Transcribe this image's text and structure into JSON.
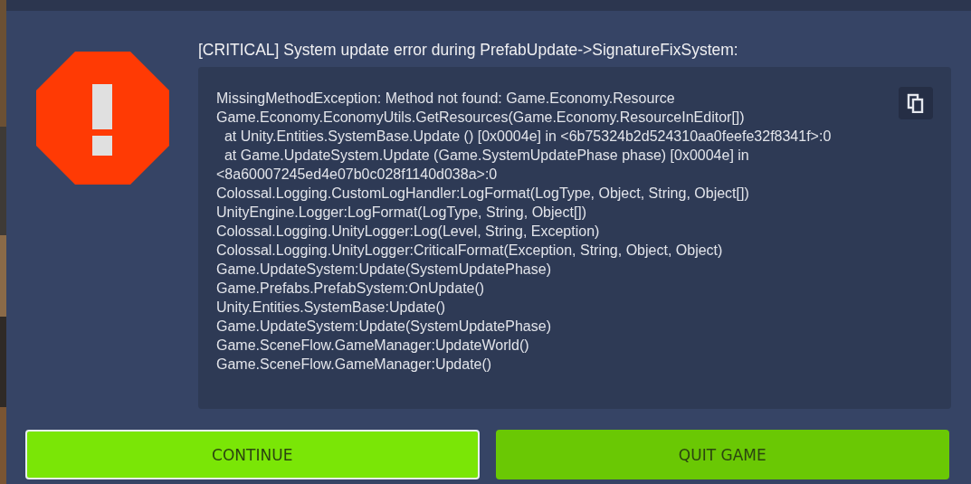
{
  "dialog": {
    "title": "[CRITICAL] System update error during PrefabUpdate->SignatureFixSystem:",
    "log_lines": [
      "MissingMethodException: Method not found: Game.Economy.Resource",
      "Game.Economy.EconomyUtils.GetResources(Game.Economy.ResourceInEditor[])",
      "  at Unity.Entities.SystemBase.Update () [0x0004e] in <6b75324b2d524310aa0feefe32f8341f>:0",
      "  at Game.UpdateSystem.Update (Game.SystemUpdatePhase phase) [0x0004e] in",
      "<8a60007245ed4e07b0c028f1140d038a>:0",
      "Colossal.Logging.CustomLogHandler:LogFormat(LogType, Object, String, Object[])",
      "UnityEngine.Logger:LogFormat(LogType, String, Object[])",
      "Colossal.Logging.UnityLogger:Log(Level, String, Exception)",
      "Colossal.Logging.UnityLogger:CriticalFormat(Exception, String, Object, Object)",
      "Game.UpdateSystem:Update(SystemUpdatePhase)",
      "Game.Prefabs.PrefabSystem:OnUpdate()",
      "Unity.Entities.SystemBase:Update()",
      "Game.UpdateSystem:Update(SystemUpdatePhase)",
      "Game.SceneFlow.GameManager:UpdateWorld()",
      "Game.SceneFlow.GameManager:Update()"
    ],
    "buttons": [
      {
        "label": "CONTINUE",
        "selected": true
      },
      {
        "label": "QUIT GAME",
        "selected": false
      }
    ]
  }
}
